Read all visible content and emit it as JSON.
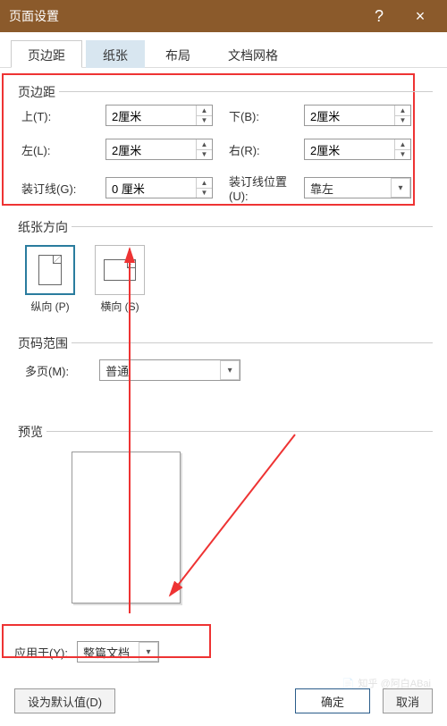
{
  "titlebar": {
    "title": "页面设置",
    "help": "?",
    "close": "×"
  },
  "tabs": {
    "items": [
      "页边距",
      "纸张",
      "布局",
      "文档网格"
    ],
    "active_index": 0,
    "hover_index": 1
  },
  "margins": {
    "legend": "页边距",
    "top_label": "上(T):",
    "top_value": "2厘米",
    "bottom_label": "下(B):",
    "bottom_value": "2厘米",
    "left_label": "左(L):",
    "left_value": "2厘米",
    "right_label": "右(R):",
    "right_value": "2厘米",
    "gutter_label": "装订线(G):",
    "gutter_value": "0 厘米",
    "gutter_pos_label": "装订线位置(U):",
    "gutter_pos_value": "靠左"
  },
  "orientation": {
    "legend": "纸张方向",
    "portrait_label": "纵向 (P)",
    "landscape_label": "横向 (S)",
    "active": "portrait"
  },
  "pages": {
    "legend": "页码范围",
    "multi_label": "多页(M):",
    "multi_value": "普通"
  },
  "preview": {
    "legend": "预览"
  },
  "apply": {
    "label": "应用于(Y):",
    "value": "整篇文档"
  },
  "buttons": {
    "default": "设为默认值(D)",
    "ok": "确定",
    "cancel": "取消"
  },
  "watermark": "知乎 @阿白ABai"
}
